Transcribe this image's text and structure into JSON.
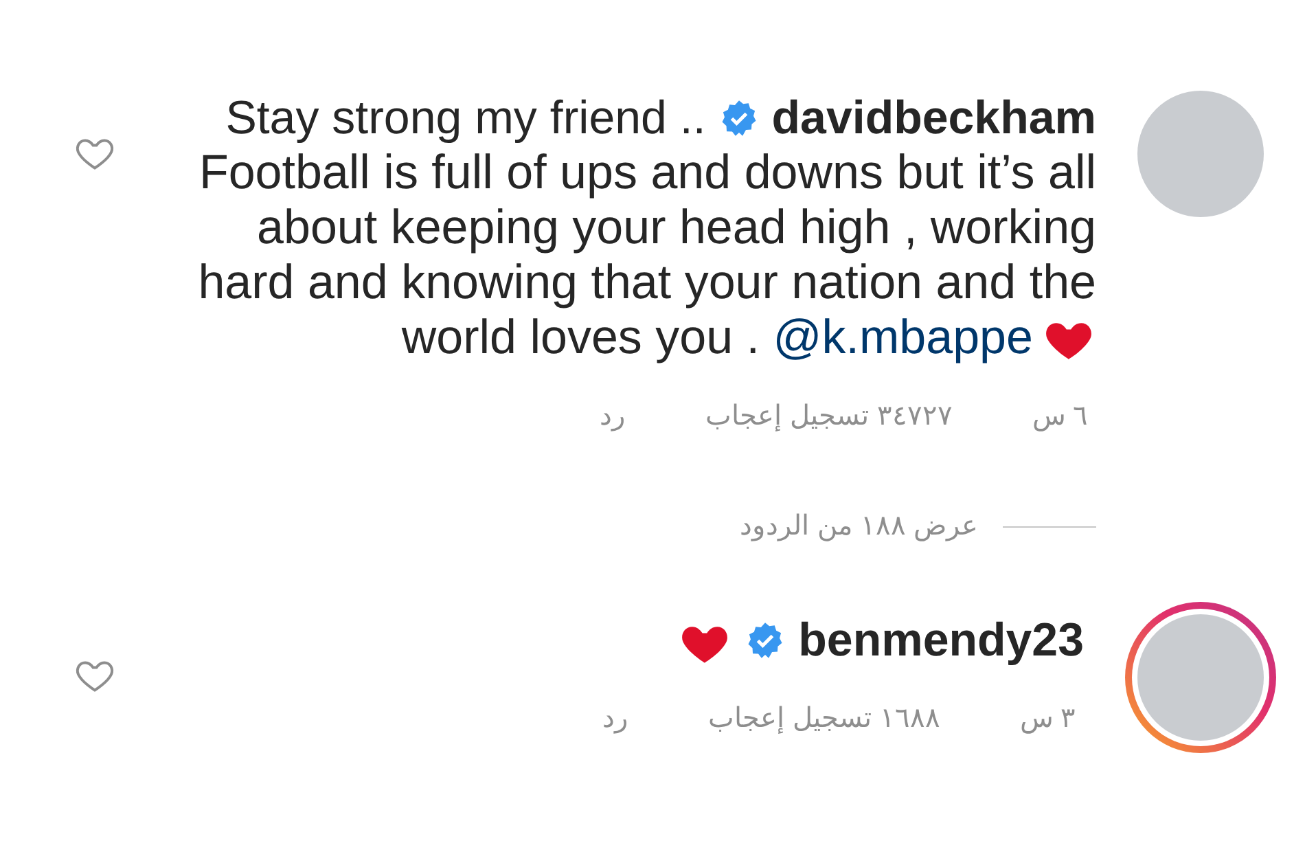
{
  "comments": [
    {
      "username": "davidbeckham",
      "verified": true,
      "lead": "Stay strong my friend ..",
      "body": "Football is full of ups and downs but it’s all about keeping your head high , working hard and knowing that your nation and the world loves you .",
      "mention": "@k.mbappe",
      "heart": true,
      "story_ring": false,
      "time": "٦ س",
      "likes": "٣٤٧٢٧ تسجيل إعجاب",
      "reply": "رد",
      "view_replies": "عرض ١٨٨ من الردود"
    },
    {
      "username": "benmendy23",
      "verified": true,
      "heart": true,
      "story_ring": true,
      "time": "٣ س",
      "likes": "١٦٨٨ تسجيل إعجاب",
      "reply": "رد"
    }
  ]
}
